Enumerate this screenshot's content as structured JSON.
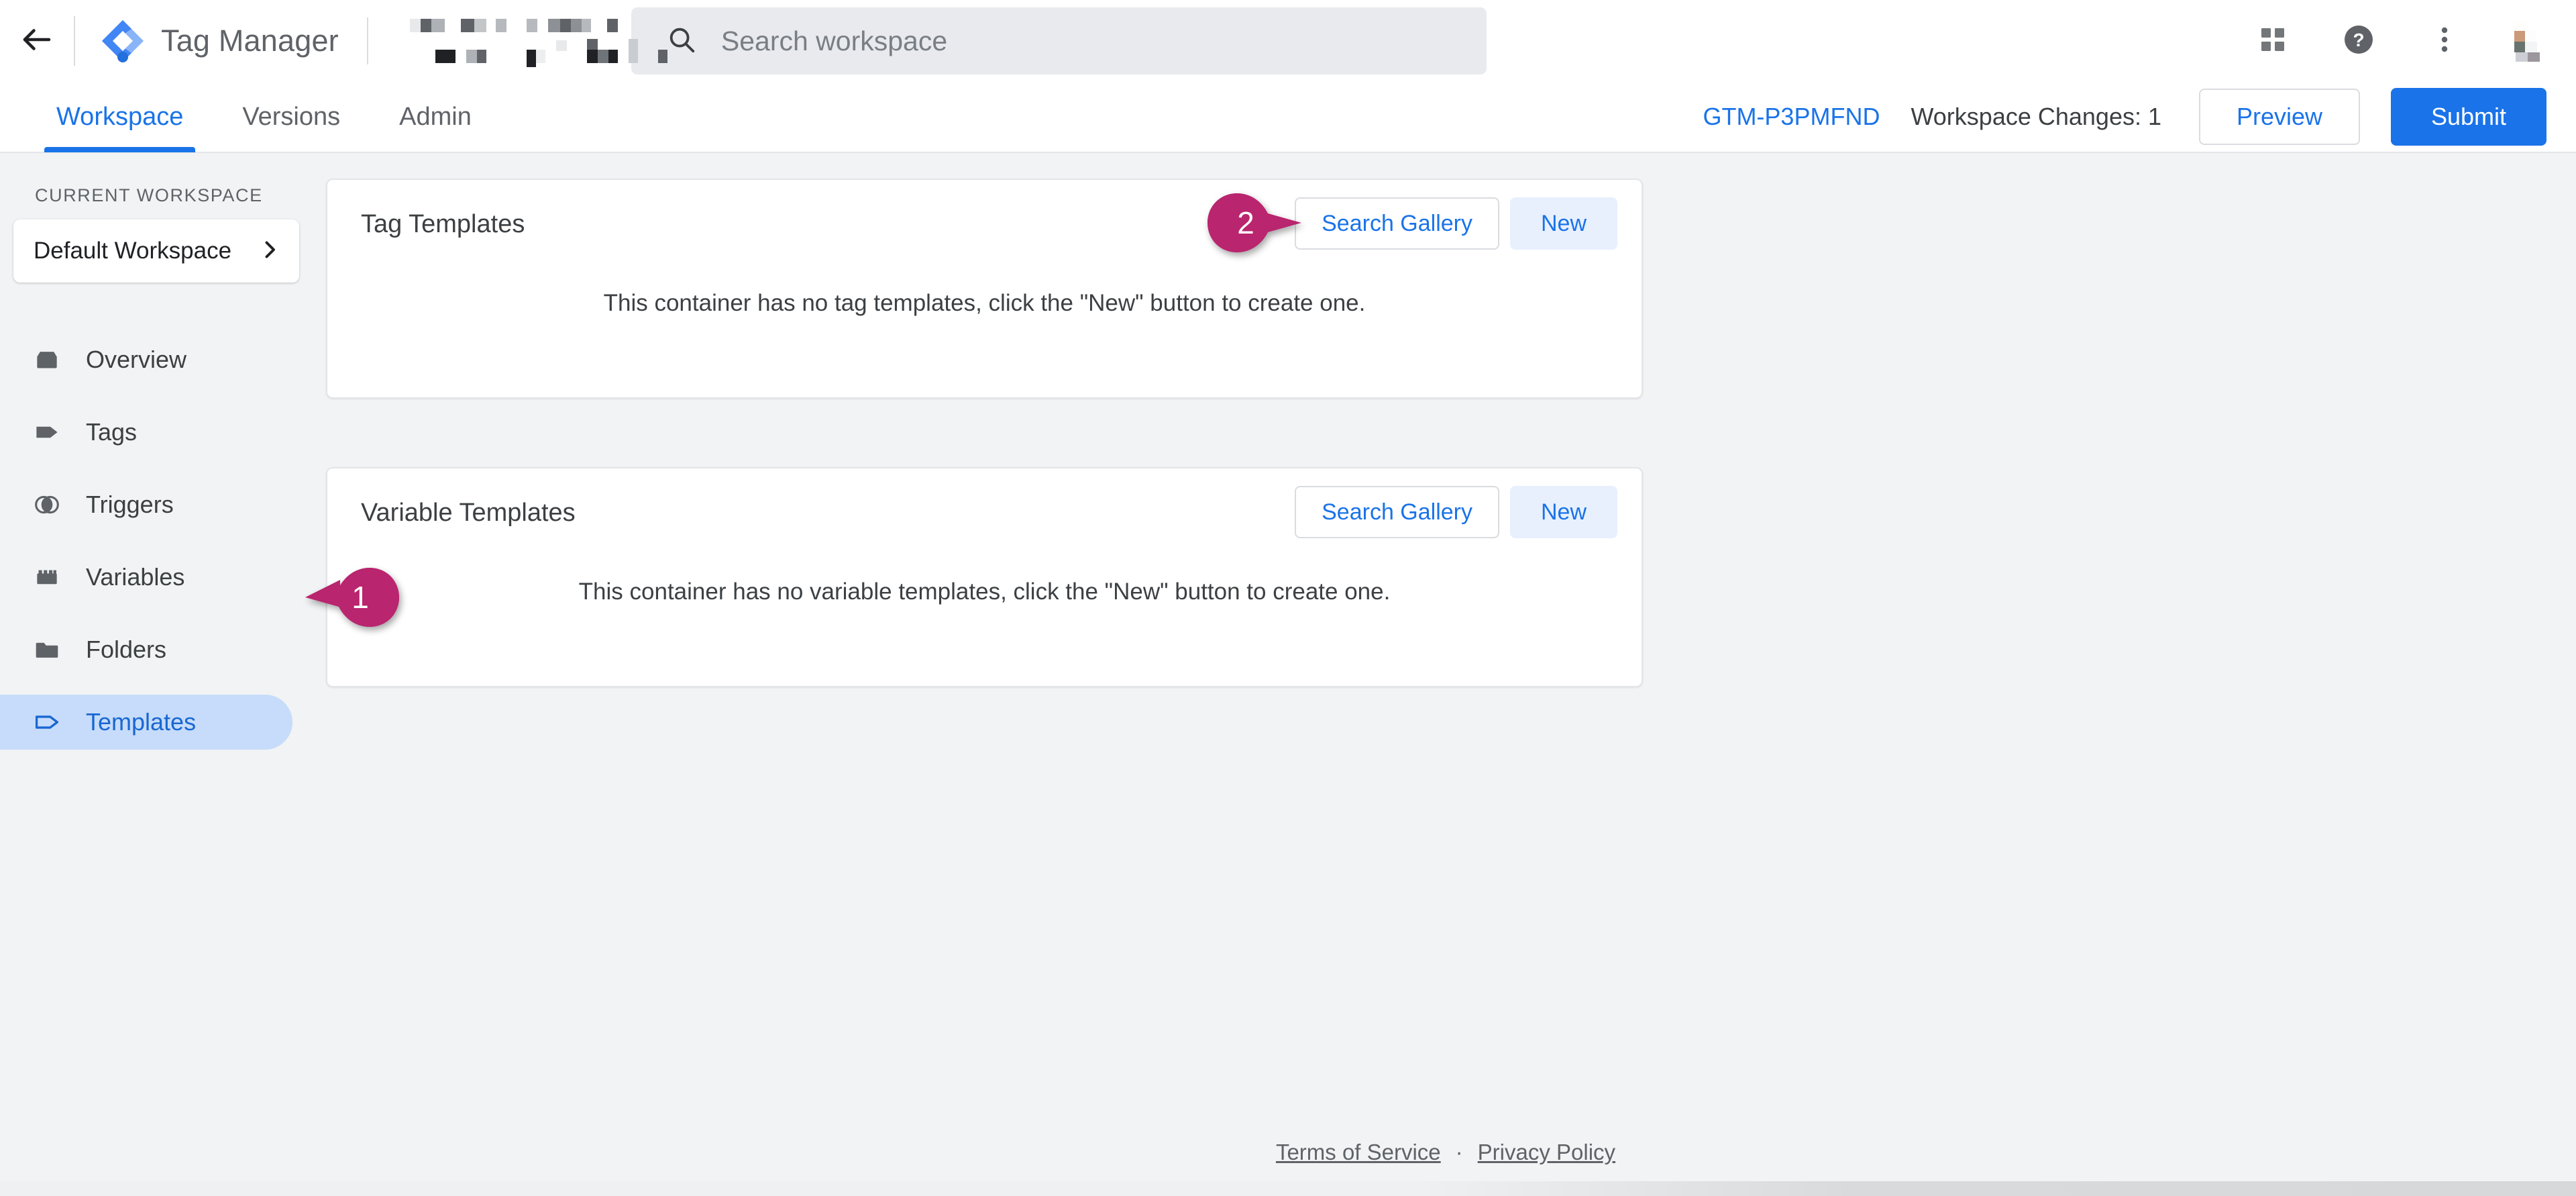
{
  "header": {
    "back_icon": "back-arrow-icon",
    "logo_icon": "google-tag-manager-logo",
    "title": "Tag Manager",
    "account_container_redacted": true,
    "search": {
      "icon": "search-icon",
      "placeholder": "Search workspace",
      "value": ""
    },
    "apps_icon": "apps-grid-icon",
    "help_icon": "help-circle-icon",
    "more_icon": "more-vert-icon",
    "avatar": "user-avatar-redacted"
  },
  "nav": {
    "tabs": [
      {
        "label": "Workspace",
        "active": true
      },
      {
        "label": "Versions",
        "active": false
      },
      {
        "label": "Admin",
        "active": false
      }
    ],
    "container_id": "GTM-P3PMFND",
    "workspace_changes": "Workspace Changes: 1",
    "preview_label": "Preview",
    "submit_label": "Submit"
  },
  "sidebar": {
    "section_label": "CURRENT WORKSPACE",
    "workspace_name": "Default Workspace",
    "workspace_chevron": "chevron-right-icon",
    "items": [
      {
        "label": "Overview",
        "icon": "overview-box-icon",
        "active": false
      },
      {
        "label": "Tags",
        "icon": "tag-filled-icon",
        "active": false
      },
      {
        "label": "Triggers",
        "icon": "triggers-circles-icon",
        "active": false
      },
      {
        "label": "Variables",
        "icon": "variables-brick-icon",
        "active": false
      },
      {
        "label": "Folders",
        "icon": "folder-icon",
        "active": false
      },
      {
        "label": "Templates",
        "icon": "tag-outline-icon",
        "active": true
      }
    ]
  },
  "main": {
    "cards": [
      {
        "title": "Tag Templates",
        "search_gallery_label": "Search Gallery",
        "new_label": "New",
        "empty_message": "This container has no tag templates, click the \"New\" button to create one."
      },
      {
        "title": "Variable Templates",
        "search_gallery_label": "Search Gallery",
        "new_label": "New",
        "empty_message": "This container has no variable templates, click the \"New\" button to create one."
      }
    ]
  },
  "annotations": [
    {
      "number": "1",
      "direction": "left",
      "target": "sidebar-item-templates"
    },
    {
      "number": "2",
      "direction": "right",
      "target": "tag-templates-search-gallery-button"
    }
  ],
  "footer": {
    "terms_label": "Terms of Service",
    "separator": "·",
    "privacy_label": "Privacy Policy"
  },
  "colors": {
    "accent_blue": "#1a73e8",
    "active_nav_bg": "#c6dcfa",
    "page_bg": "#f1f3f4",
    "marker_magenta": "#b9256e",
    "new_button_bg": "#e8f0fe"
  }
}
